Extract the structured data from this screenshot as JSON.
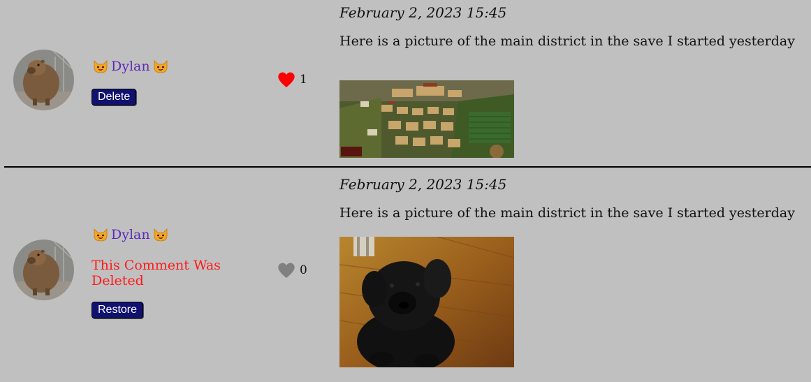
{
  "comments": [
    {
      "author": "Dylan",
      "author_prefix_icon": "cat-face-icon",
      "author_suffix_icon": "cat-face-icon",
      "action_label": "Delete",
      "likes": "1",
      "liked": true,
      "timestamp": "February 2, 2023 15:45",
      "body": "Here is a picture of the main district in the save I started yesterday",
      "image": "city-screenshot-image"
    },
    {
      "author": "Dylan",
      "author_prefix_icon": "cat-face-icon",
      "author_suffix_icon": "cat-face-icon",
      "deleted_notice": "This Comment Was Deleted",
      "action_label": "Restore",
      "likes": "0",
      "liked": false,
      "timestamp": "February 2, 2023 15:45",
      "body": "Here is a picture of the main district in the save I started yesterday",
      "image": "puppy-photo-image"
    }
  ],
  "colors": {
    "background": "#c0c0c0",
    "author": "#5b2ab8",
    "button_bg": "#111270",
    "deleted_text": "#ff1a1a",
    "heart_liked": "#ff0000",
    "heart_unliked": "#808080"
  }
}
